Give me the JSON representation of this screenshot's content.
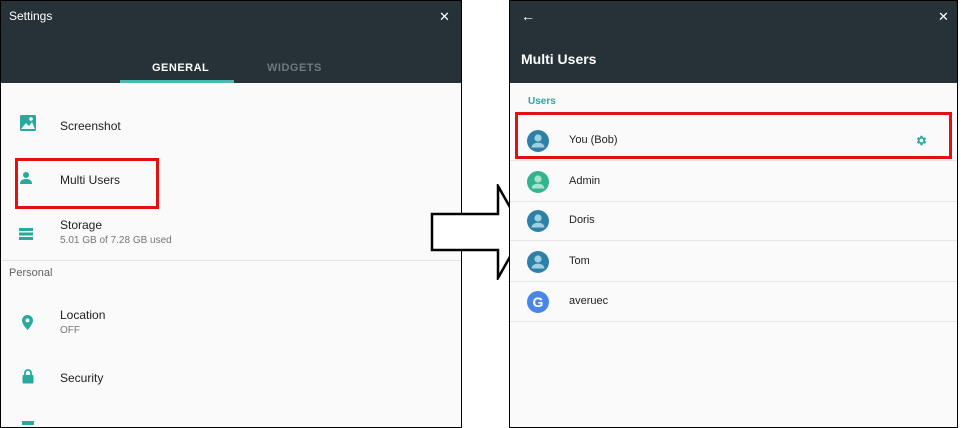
{
  "left": {
    "title": "Settings",
    "close_icon": "close-icon",
    "tabs": [
      {
        "label": "GENERAL",
        "active": true
      },
      {
        "label": "WIDGETS",
        "active": false
      }
    ],
    "items": [
      {
        "label": "Screenshot",
        "icon": "screenshot-icon"
      },
      {
        "label": "Multi Users",
        "icon": "person-icon"
      },
      {
        "label": "Storage",
        "sub": "5.01 GB of 7.28 GB used",
        "icon": "storage-icon"
      }
    ],
    "section": "Personal",
    "personal_items": [
      {
        "label": "Location",
        "sub": "OFF",
        "icon": "location-icon"
      },
      {
        "label": "Security",
        "icon": "lock-icon"
      }
    ]
  },
  "right": {
    "title": "Multi Users",
    "back_icon": "back-arrow-icon",
    "close_icon": "close-icon",
    "section": "Users",
    "users": [
      {
        "name": "You (Bob)",
        "avatar_color": "#2f80a7",
        "settings": true
      },
      {
        "name": "Admin",
        "avatar_color": "#33b48e"
      },
      {
        "name": "Doris",
        "avatar_color": "#2f80a7"
      },
      {
        "name": "Tom",
        "avatar_color": "#2f80a7"
      },
      {
        "name": "averuec",
        "avatar_color": "#4a86e8",
        "google": true
      }
    ]
  },
  "colors": {
    "header": "#263238",
    "accent": "#27a99e",
    "highlight": "#e31010"
  }
}
